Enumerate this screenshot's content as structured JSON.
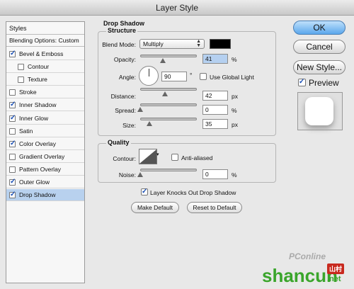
{
  "window": {
    "title": "Layer Style"
  },
  "sidebar": {
    "header": "Styles",
    "blending": "Blending Options: Custom",
    "items": [
      {
        "label": "Bevel & Emboss",
        "checked": true,
        "indent": false
      },
      {
        "label": "Contour",
        "checked": false,
        "indent": true
      },
      {
        "label": "Texture",
        "checked": false,
        "indent": true
      },
      {
        "label": "Stroke",
        "checked": false,
        "indent": false
      },
      {
        "label": "Inner Shadow",
        "checked": true,
        "indent": false
      },
      {
        "label": "Inner Glow",
        "checked": true,
        "indent": false
      },
      {
        "label": "Satin",
        "checked": false,
        "indent": false
      },
      {
        "label": "Color Overlay",
        "checked": true,
        "indent": false
      },
      {
        "label": "Gradient Overlay",
        "checked": false,
        "indent": false
      },
      {
        "label": "Pattern Overlay",
        "checked": false,
        "indent": false
      },
      {
        "label": "Outer Glow",
        "checked": true,
        "indent": false
      },
      {
        "label": "Drop Shadow",
        "checked": true,
        "indent": false,
        "selected": true
      }
    ]
  },
  "drop_shadow": {
    "title": "Drop Shadow",
    "structure_title": "Structure",
    "blend_mode_label": "Blend Mode:",
    "blend_mode_value": "Multiply",
    "shadow_color": "#000000",
    "opacity_label": "Opacity:",
    "opacity_value": "41",
    "opacity_unit": "%",
    "angle_label": "Angle:",
    "angle_value": "90",
    "angle_unit": "°",
    "global_light_label": "Use Global Light",
    "distance_label": "Distance:",
    "distance_value": "42",
    "distance_unit": "px",
    "spread_label": "Spread:",
    "spread_value": "0",
    "spread_unit": "%",
    "size_label": "Size:",
    "size_value": "35",
    "size_unit": "px",
    "quality_title": "Quality",
    "contour_label": "Contour:",
    "anti_aliased_label": "Anti-aliased",
    "noise_label": "Noise:",
    "noise_value": "0",
    "noise_unit": "%",
    "knockout_label": "Layer Knocks Out Drop Shadow",
    "make_default": "Make Default",
    "reset_default": "Reset to Default"
  },
  "actions": {
    "ok": "OK",
    "cancel": "Cancel",
    "new_style": "New Style...",
    "preview": "Preview"
  },
  "watermark": {
    "pconline": "PConline",
    "shancun": "shancun",
    "net": ".net",
    "badge": "山村"
  }
}
